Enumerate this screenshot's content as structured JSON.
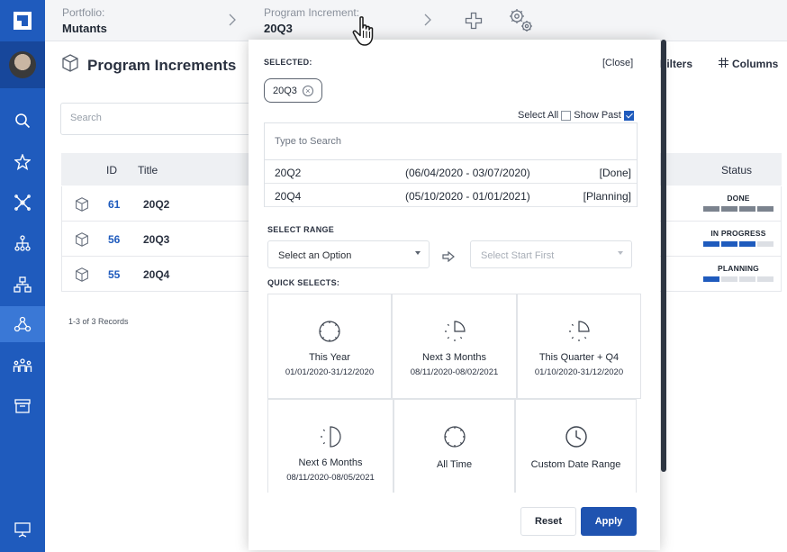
{
  "header": {
    "portfolio_label": "Portfolio:",
    "portfolio_value": "Mutants",
    "pi_label": "Program Increment:",
    "pi_value": "20Q3",
    "icons": [
      "chevron-right-icon",
      "plus-icon",
      "gears-icon"
    ]
  },
  "sidebar": {
    "items": [
      {
        "name": "logo-icon"
      },
      {
        "name": "avatar"
      },
      {
        "name": "search-icon"
      },
      {
        "name": "star-icon"
      },
      {
        "name": "network-icon"
      },
      {
        "name": "hierarchy-icon"
      },
      {
        "name": "org-chart-icon"
      },
      {
        "name": "program-icon",
        "active": true
      },
      {
        "name": "team-icon"
      },
      {
        "name": "archive-icon"
      },
      {
        "name": "presentation-icon"
      }
    ]
  },
  "page": {
    "title": "Program Increments",
    "filters_label": "Filters",
    "columns_label": "Columns",
    "search_placeholder": "Search",
    "columns": {
      "id": "ID",
      "title": "Title",
      "status": "Status"
    },
    "rows": [
      {
        "id": "61",
        "title": "20Q2",
        "status": "DONE",
        "progress": 1.0
      },
      {
        "id": "56",
        "title": "20Q3",
        "status": "IN PROGRESS",
        "progress": 0.75
      },
      {
        "id": "55",
        "title": "20Q4",
        "status": "PLANNING",
        "progress": 0.25
      }
    ],
    "records": "1-3 of 3 Records"
  },
  "modal": {
    "selected_label": "SELECTED:",
    "close_label": "[Close]",
    "chip": "20Q3",
    "select_all": "Select All",
    "show_past": "Show Past",
    "show_past_checked": true,
    "search_placeholder": "Type to Search",
    "options": [
      {
        "name": "20Q2",
        "dates": "(06/04/2020 - 03/07/2020)",
        "state": "[Done]"
      },
      {
        "name": "20Q4",
        "dates": "(05/10/2020 - 01/01/2021)",
        "state": "[Planning]"
      }
    ],
    "range_label": "SELECT RANGE",
    "range_select": "Select an Option",
    "range_end": "Select Start First",
    "quick_label": "QUICK SELECTS:",
    "tiles": [
      {
        "title": "This Year",
        "range": "01/01/2020-31/12/2020",
        "icon": "full-clock-icon"
      },
      {
        "title": "Next 3 Months",
        "range": "08/11/2020-08/02/2021",
        "icon": "quarter-clock-icon"
      },
      {
        "title": "This Quarter + Q4",
        "range": "01/10/2020-31/12/2020",
        "icon": "quarter-clock-icon"
      },
      {
        "title": "Next 6 Months",
        "range": "08/11/2020-08/05/2021",
        "icon": "half-clock-icon"
      },
      {
        "title": "All Time",
        "range": "",
        "icon": "full-clock-icon"
      },
      {
        "title": "Custom Date Range",
        "range": "",
        "icon": "clock-icon"
      }
    ],
    "reset": "Reset",
    "apply": "Apply"
  },
  "colors": {
    "brand": "#1f5bbd",
    "rail": "#1f5bbd",
    "apply": "#1f53b0",
    "done_bar": "#7b838e"
  }
}
